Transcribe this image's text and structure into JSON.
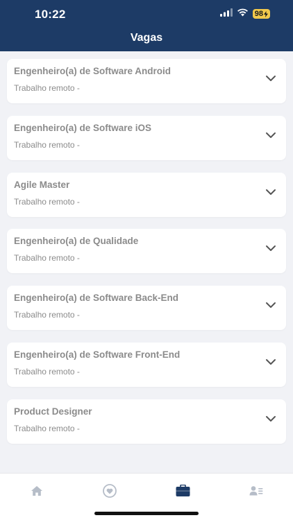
{
  "status_bar": {
    "time": "10:22",
    "battery": "98",
    "icons": [
      "cellular-signal-icon",
      "wifi-icon",
      "battery-charging-icon"
    ]
  },
  "header": {
    "title": "Vagas"
  },
  "jobs": [
    {
      "title": "Engenheiro(a) de Software Android",
      "subtitle": "Trabalho remoto -"
    },
    {
      "title": "Engenheiro(a) de Software iOS",
      "subtitle": "Trabalho remoto -"
    },
    {
      "title": "Agile Master",
      "subtitle": "Trabalho remoto -"
    },
    {
      "title": "Engenheiro(a) de Qualidade",
      "subtitle": "Trabalho remoto -"
    },
    {
      "title": "Engenheiro(a) de Software Back-End",
      "subtitle": "Trabalho remoto -"
    },
    {
      "title": "Engenheiro(a) de Software Front-End",
      "subtitle": "Trabalho remoto -"
    },
    {
      "title": "Product Designer",
      "subtitle": "Trabalho remoto -"
    }
  ],
  "tabbar": {
    "tabs": [
      {
        "icon": "home-icon",
        "active": false
      },
      {
        "icon": "heart-icon",
        "active": false
      },
      {
        "icon": "briefcase-icon",
        "active": true
      },
      {
        "icon": "user-list-icon",
        "active": false
      }
    ]
  },
  "colors": {
    "header_bg": "#1d3b66",
    "page_bg": "#f1f2f6",
    "text_muted": "#8b8b8b",
    "tab_inactive": "#b6bdc8",
    "tab_active": "#1d3b66",
    "battery": "#f2c94c"
  }
}
